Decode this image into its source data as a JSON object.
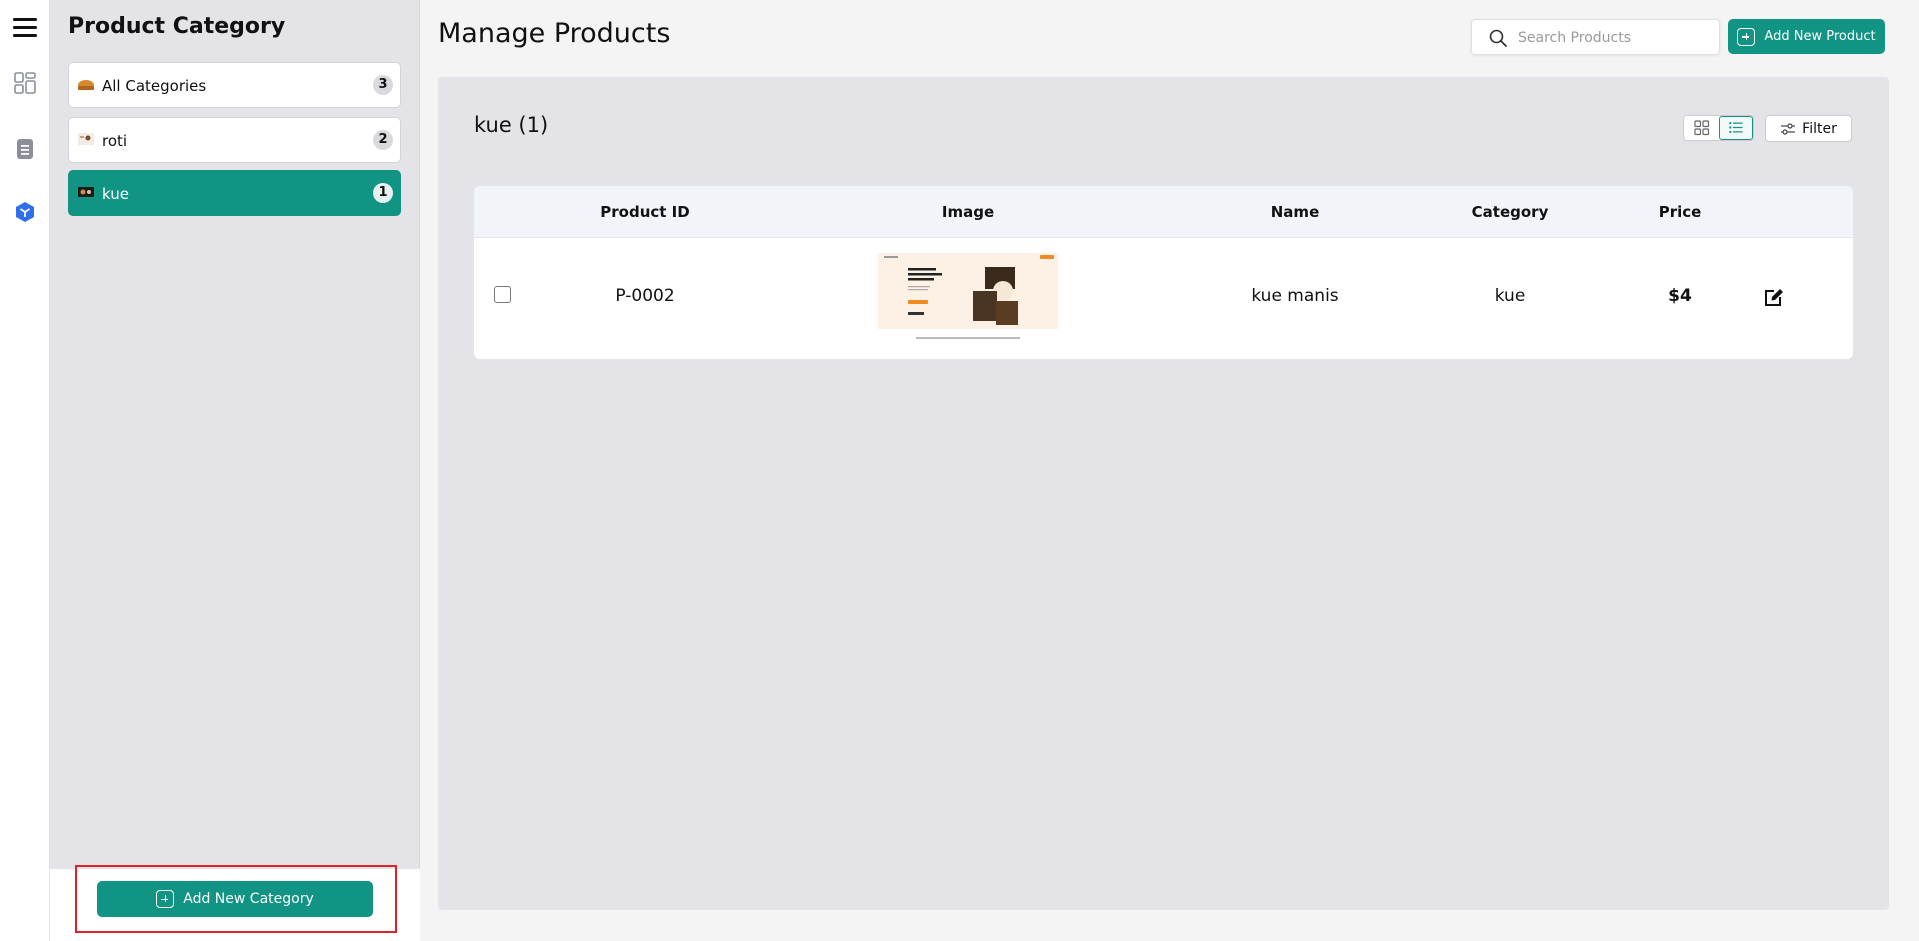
{
  "rail": {
    "icons": [
      "menu-icon",
      "dashboard-icon",
      "orders-icon",
      "products-icon"
    ],
    "accent": "#2f6fed"
  },
  "category_panel": {
    "title": "Product Category",
    "items": [
      {
        "label": "All Categories",
        "count": "3",
        "active": false
      },
      {
        "label": "roti",
        "count": "2",
        "active": false
      },
      {
        "label": "kue",
        "count": "1",
        "active": true
      }
    ],
    "add_button_label": "Add New Category"
  },
  "header": {
    "title": "Manage Products",
    "search_placeholder": "Search Products",
    "add_button_label": "Add New Product"
  },
  "list": {
    "title": "kue (1)",
    "view_modes": [
      "grid-view",
      "list-view"
    ],
    "active_view": "list-view",
    "filter_label": "Filter",
    "columns": [
      "Product ID",
      "Image",
      "Name",
      "Category",
      "Price"
    ],
    "rows": [
      {
        "id": "P-0002",
        "name": "kue manis",
        "category": "kue",
        "price": "$4"
      }
    ]
  },
  "colors": {
    "primary": "#119484",
    "highlight": "#e0222a"
  }
}
